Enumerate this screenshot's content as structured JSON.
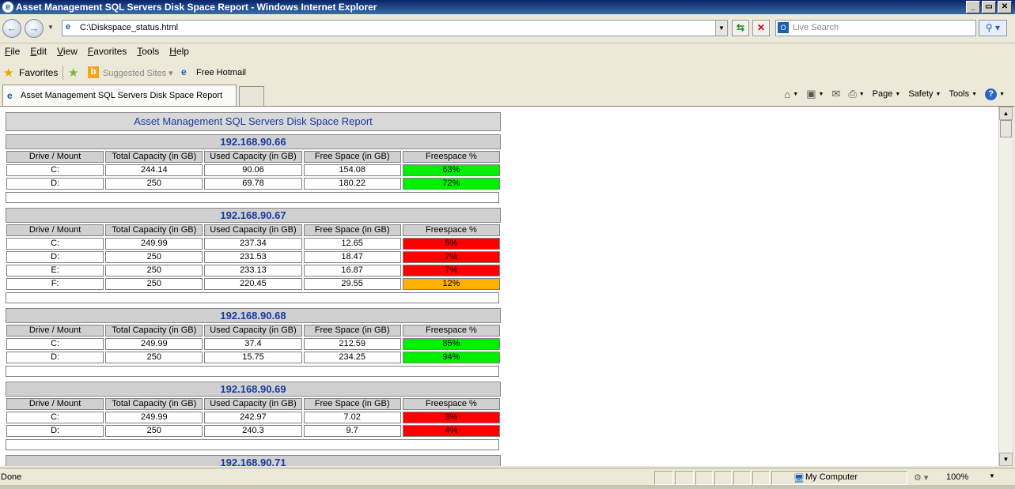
{
  "window": {
    "title": "Asset Management SQL Servers Disk Space Report - Windows Internet Explorer",
    "controls": [
      "_",
      "▭",
      "✕"
    ]
  },
  "address": {
    "url": "C:\\Diskspace_status.html"
  },
  "search": {
    "placeholder": "Live Search"
  },
  "menu": [
    {
      "key": "F",
      "rest": "ile"
    },
    {
      "key": "E",
      "rest": "dit"
    },
    {
      "key": "V",
      "rest": "iew"
    },
    {
      "key": "F",
      "rest": "avorites",
      "pre": ""
    },
    {
      "key": "T",
      "rest": "ools"
    },
    {
      "key": "H",
      "rest": "elp"
    }
  ],
  "favorites": {
    "label": "Favorites",
    "suggested": "Suggested Sites ▾",
    "hotmail": "Free Hotmail"
  },
  "tab": {
    "title": "Asset Management SQL Servers Disk Space Report"
  },
  "commands": {
    "page": "Page",
    "safety": "Safety",
    "tools": "Tools"
  },
  "report": {
    "title": "Asset Management SQL Servers Disk Space Report",
    "headers": [
      "Drive / Mount",
      "Total Capacity (in GB)",
      "Used Capacity (in GB)",
      "Free Space (in GB)",
      "Freespace %"
    ],
    "servers": [
      {
        "host": "192.168.90.66",
        "rows": [
          {
            "drive": "C:",
            "total": "244.14",
            "used": "90.06",
            "free": "154.08",
            "pct": "63%",
            "status": "green"
          },
          {
            "drive": "D:",
            "total": "250",
            "used": "69.78",
            "free": "180.22",
            "pct": "72%",
            "status": "green"
          }
        ]
      },
      {
        "host": "192.168.90.67",
        "rows": [
          {
            "drive": "C:",
            "total": "249.99",
            "used": "237.34",
            "free": "12.65",
            "pct": "5%",
            "status": "red"
          },
          {
            "drive": "D:",
            "total": "250",
            "used": "231.53",
            "free": "18.47",
            "pct": "7%",
            "status": "red"
          },
          {
            "drive": "E:",
            "total": "250",
            "used": "233.13",
            "free": "16.87",
            "pct": "7%",
            "status": "red"
          },
          {
            "drive": "F:",
            "total": "250",
            "used": "220.45",
            "free": "29.55",
            "pct": "12%",
            "status": "orange"
          }
        ]
      },
      {
        "host": "192.168.90.68",
        "rows": [
          {
            "drive": "C:",
            "total": "249.99",
            "used": "37.4",
            "free": "212.59",
            "pct": "85%",
            "status": "green"
          },
          {
            "drive": "D:",
            "total": "250",
            "used": "15.75",
            "free": "234.25",
            "pct": "94%",
            "status": "green"
          }
        ]
      },
      {
        "host": "192.168.90.69",
        "rows": [
          {
            "drive": "C:",
            "total": "249.99",
            "used": "242.97",
            "free": "7.02",
            "pct": "3%",
            "status": "red"
          },
          {
            "drive": "D:",
            "total": "250",
            "used": "240.3",
            "free": "9.7",
            "pct": "4%",
            "status": "red"
          }
        ]
      },
      {
        "host": "192.168.90.71",
        "rows": []
      }
    ]
  },
  "status": {
    "text": "Done",
    "zone": "My Computer",
    "zoom": "100%"
  },
  "colors": {
    "green": "#00f000",
    "red": "#ff0000",
    "orange": "#ffb000"
  }
}
